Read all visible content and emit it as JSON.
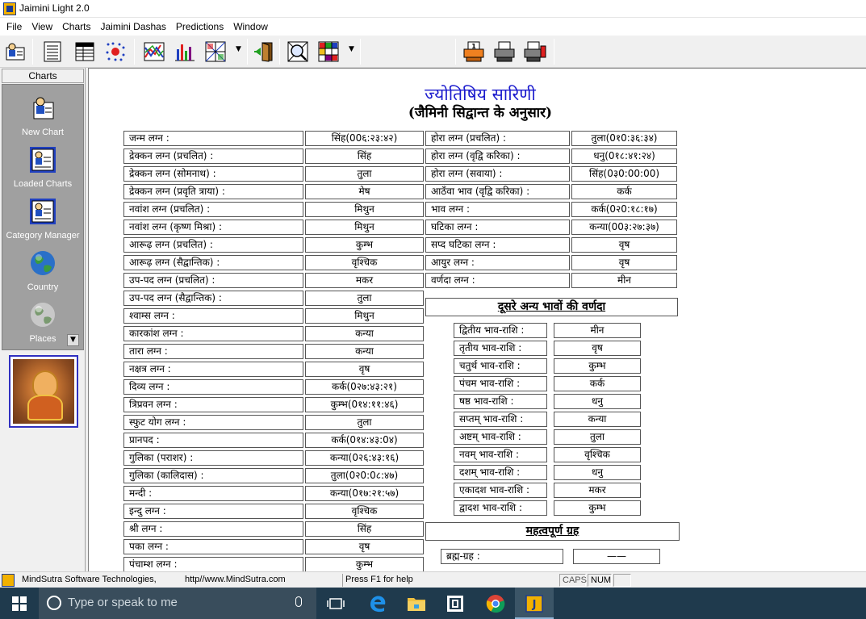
{
  "window": {
    "title": "Jaimini Light 2.0"
  },
  "menu": [
    "File",
    "View",
    "Charts",
    "Jaimini Dashas",
    "Predictions",
    "Window"
  ],
  "left_panel": {
    "tab_label": "Charts",
    "shortcuts": [
      {
        "label": "New Chart",
        "icon": "new-chart-icon"
      },
      {
        "label": "Loaded Charts",
        "icon": "loaded-charts-icon"
      },
      {
        "label": "Category Manager",
        "icon": "category-manager-icon"
      },
      {
        "label": "Country",
        "icon": "globe-icon"
      },
      {
        "label": "Places",
        "icon": "places-icon"
      }
    ]
  },
  "document": {
    "title": "ज्योतिषिय सारिणी",
    "subtitle": "(जैमिनी सिद्वान्त के अनुसार)",
    "left_rows": [
      [
        "जन्म लग्न :",
        "सिंह(00६:२३:४२)"
      ],
      [
        "द्रेक्कन लग्न (प्रचलित) :",
        "सिंह"
      ],
      [
        "द्रेक्कन लग्न  (सोमनाथ) :",
        "तुला"
      ],
      [
        "द्रेक्कन लग्न  (प्रवृति त्राया) :",
        "मेष"
      ],
      [
        "नवांश लग्न (प्रचलित) :",
        "मिथुन"
      ],
      [
        "नवांश लग्न (कृष्ण मिश्रा) :",
        "मिथुन"
      ],
      [
        "आरूढ़ लग्न (प्रचलित) :",
        "कुम्भ"
      ],
      [
        "आरूढ़ लग्न (सैद्वान्तिक) :",
        "वृश्चिक"
      ],
      [
        "उप-पद लग्न (प्रचलित) :",
        "मकर"
      ],
      [
        "उप-पद लग्न (सैद्वान्तिक) :",
        "तुला"
      ],
      [
        "श्वाम्स लग्न :",
        "मिथुन"
      ],
      [
        "कारकांश लग्न :",
        "कन्या"
      ],
      [
        "तारा लग्न :",
        "कन्या"
      ],
      [
        "नक्षत्र लग्न :",
        "वृष"
      ],
      [
        "दिव्य लग्न :",
        "कर्क(0२७:४३:२१)"
      ],
      [
        "त्रिप्रवन लग्न :",
        "कुम्भ(0१४:११:४६)"
      ],
      [
        "स्फुट योग लग्न :",
        "तुला"
      ],
      [
        "प्रानपद :",
        "कर्क(0१४:४३:0४)"
      ],
      [
        "गुलिका (पराशर) :",
        "कन्या(0२६:४३:१६)"
      ],
      [
        "गुलिका (कालिदास) :",
        "तुला(0२0:0८:४७)"
      ],
      [
        "मन्दी :",
        "कन्या(0१७:२१:५७)"
      ],
      [
        "इन्दु लग्न :",
        "वृश्चिक"
      ],
      [
        "श्री लग्न :",
        "सिंह"
      ],
      [
        "पका लग्न :",
        "वृष"
      ],
      [
        "पंचाम्श लग्न :",
        "कुम्भ"
      ]
    ],
    "right_rows": [
      [
        "होरा लग्न (प्रचलित) :",
        "तुला(0१0:३६:३४)"
      ],
      [
        "होरा लग्न (वृद्वि करिका) :",
        "धनु(0१८:४१:२४)"
      ],
      [
        "होरा लग्न (सवाया) :",
        "सिंह(0३0:00:00)"
      ],
      [
        "आठँवा भाव (वृद्वि करिका) :",
        "कर्क"
      ],
      [
        "भाव लग्न :",
        "कर्क(0२0:१८:१७)"
      ],
      [
        "घटिका लग्न :",
        "कन्या(00३:२७:३७)"
      ],
      [
        "सप्द घटिका लग्न :",
        "वृष"
      ],
      [
        "आयुर लग्न :",
        "वृष"
      ],
      [
        "वर्णदा लग्न :",
        "मीन"
      ]
    ],
    "section_other": "दूसरे अन्य भावों की वर्णदा",
    "bhava_rows": [
      [
        "द्वितीय भाव-राशि :",
        "मीन"
      ],
      [
        "तृतीय भाव-राशि :",
        "वृष"
      ],
      [
        "चतुर्थ भाव-राशि :",
        "कुम्भ"
      ],
      [
        "पंचम भाव-राशि :",
        "कर्क"
      ],
      [
        "षष्ठ भाव-राशि :",
        "धनु"
      ],
      [
        "सप्तम् भाव-राशि :",
        "कन्या"
      ],
      [
        "अष्टम् भाव-राशि :",
        "तुला"
      ],
      [
        "नवम् भाव-राशि :",
        "वृश्चिक"
      ],
      [
        "दशम् भाव-राशि :",
        "धनु"
      ],
      [
        "एकादश भाव-राशि :",
        "मकर"
      ],
      [
        "द्वादश भाव-राशि :",
        "कुम्भ"
      ]
    ],
    "section_important": "महत्वपूर्ण ग्रह",
    "important_rows": [
      [
        "ब्रह्म-ग्रह :",
        "——"
      ]
    ]
  },
  "statusbar": {
    "company": "MindSutra Software Technologies,",
    "url": "http//www.MindSutra.com",
    "help": "Press F1 for help",
    "caps": "CAPS",
    "num": "NUM"
  },
  "taskbar": {
    "search_placeholder": "Type or speak to me"
  },
  "colors": {
    "title_blue": "#1a1acd",
    "taskbar": "#1f3a4d",
    "panel_gray": "#a0a0a0"
  }
}
